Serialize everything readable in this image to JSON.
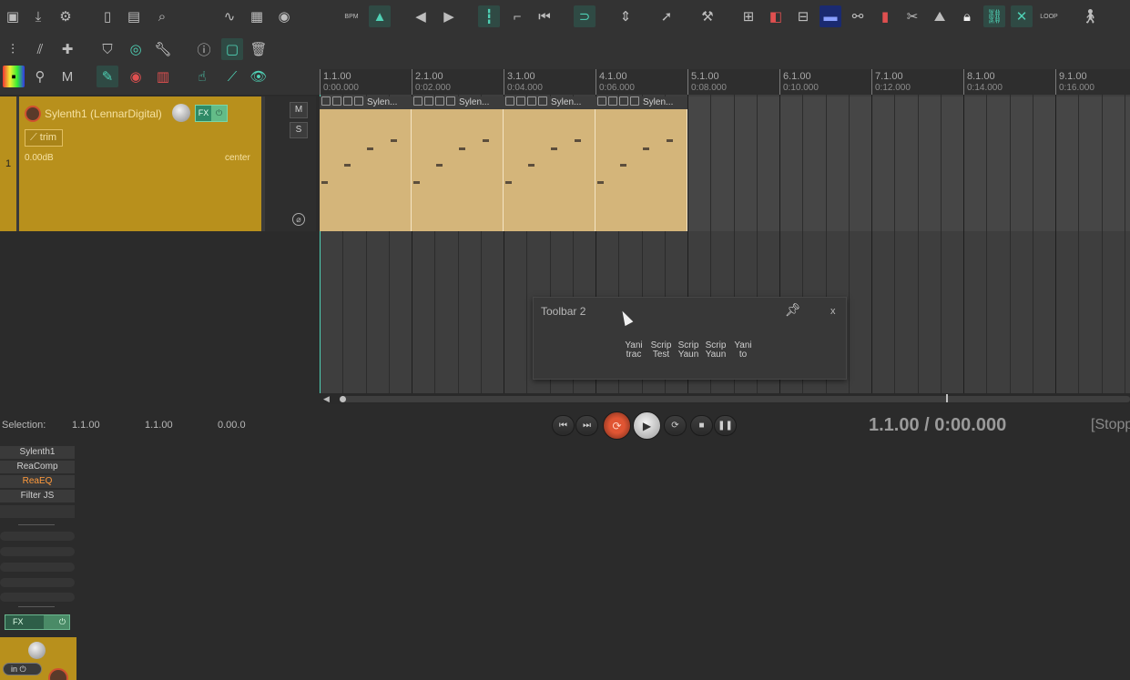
{
  "ruler": {
    "markers": [
      {
        "measure": "1.1.00",
        "time": "0:00.000"
      },
      {
        "measure": "2.1.00",
        "time": "0:02.000"
      },
      {
        "measure": "3.1.00",
        "time": "0:04.000"
      },
      {
        "measure": "4.1.00",
        "time": "0:06.000"
      },
      {
        "measure": "5.1.00",
        "time": "0:08.000"
      },
      {
        "measure": "6.1.00",
        "time": "0:10.000"
      },
      {
        "measure": "7.1.00",
        "time": "0:12.000"
      },
      {
        "measure": "8.1.00",
        "time": "0:14.000"
      },
      {
        "measure": "9.1.00",
        "time": "0:16.000"
      }
    ]
  },
  "track": {
    "number": "1",
    "name": "Sylenth1 (LennarDigital)",
    "fx_label": "FX",
    "trim_label": "trim",
    "volume": "0.00dB",
    "pan": "center",
    "mute_label": "M",
    "solo_label": "S",
    "phase_label": "⌀",
    "color": "#b8901c"
  },
  "items": [
    {
      "name": "Sylen..."
    },
    {
      "name": "Sylen..."
    },
    {
      "name": "Sylen..."
    },
    {
      "name": "Sylen..."
    }
  ],
  "toolbar2": {
    "title": "Toolbar 2",
    "close_label": "x",
    "buttons": [
      {
        "line1": "Yani",
        "line2": "trac"
      },
      {
        "line1": "Scrip",
        "line2": "Test"
      },
      {
        "line1": "Scrip",
        "line2": "Yaun"
      },
      {
        "line1": "Scrip",
        "line2": "Yaun"
      },
      {
        "line1": "Yani",
        "line2": "to"
      }
    ]
  },
  "transport": {
    "selection_label": "Selection:",
    "selection_start": "1.1.00",
    "selection_end": "1.1.00",
    "selection_length": "0.00.0",
    "position": "1.1.00 / 0:00.000",
    "status": "[Stopped]"
  },
  "mixer": {
    "fx_chain": [
      {
        "name": "Sylenth1",
        "active": false
      },
      {
        "name": "ReaComp",
        "active": false
      },
      {
        "name": "ReaEQ",
        "active": true
      },
      {
        "name": "Filter JS",
        "active": false
      }
    ],
    "fx_label": "FX",
    "input_label": "in"
  },
  "colors": {
    "accent": "#4fd1b5",
    "track": "#b8901c",
    "item": "#d4b57a",
    "record": "#e05533"
  }
}
